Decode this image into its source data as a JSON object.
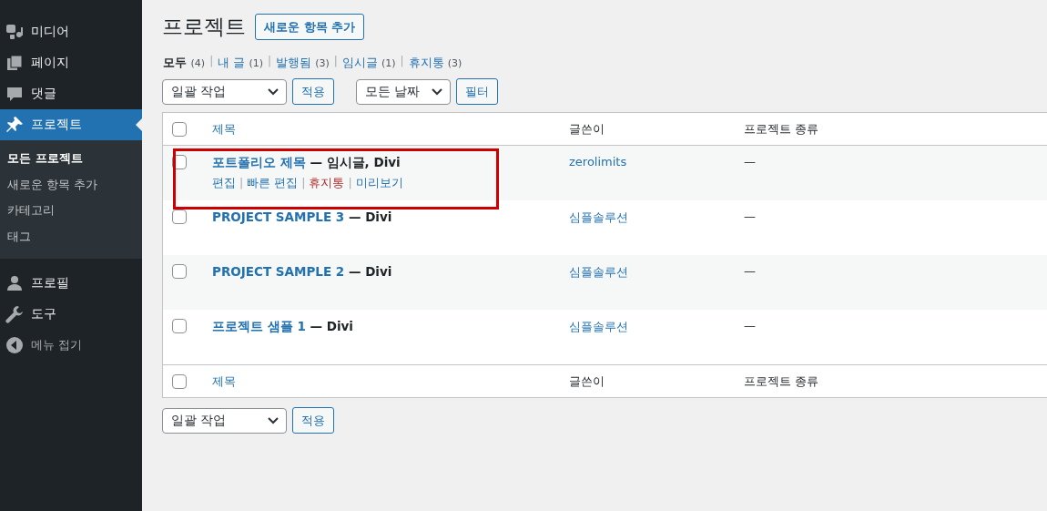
{
  "sidebar": {
    "items": [
      {
        "label": "미디어",
        "selected": false
      },
      {
        "label": "페이지",
        "selected": false
      },
      {
        "label": "댓글",
        "selected": false
      },
      {
        "label": "프로젝트",
        "selected": true,
        "expanded": true,
        "children": [
          {
            "label": "모든 프로젝트",
            "selected": true
          },
          {
            "label": "새로운 항목 추가",
            "selected": false
          },
          {
            "label": "카테고리",
            "selected": false
          },
          {
            "label": "태그",
            "selected": false
          }
        ]
      },
      {
        "label": "프로필",
        "selected": false
      },
      {
        "label": "도구",
        "selected": false
      }
    ],
    "collapse": "메뉴 접기"
  },
  "page": {
    "title": "프로젝트",
    "add_button": "새로운 항목 추가"
  },
  "views": [
    {
      "label": "모두",
      "count": "(4)",
      "selected": true
    },
    {
      "separator": "|",
      "label": "내 글",
      "count": "(1)",
      "selected": false
    },
    {
      "separator": "|",
      "label": "발행됨",
      "count": "(3)",
      "selected": false
    },
    {
      "separator": "|",
      "label": "임시글",
      "count": "(1)",
      "selected": false
    },
    {
      "separator": "|",
      "label": "휴지통",
      "count": "(3)",
      "selected": false
    }
  ],
  "top_actions": {
    "bulk": "일괄 작업",
    "apply": "적용",
    "date": "모든 날짜",
    "filter": "필터"
  },
  "table": {
    "header_checkbox": {
      "checked": false
    },
    "columns": [
      "제목",
      "글쓴이",
      "프로젝트 종류"
    ],
    "rows": [
      {
        "title": "포트폴리오 제목",
        "state": " — 임시글, Divi",
        "author": "zerolimits",
        "type": "—",
        "checked": false,
        "highlighted": true,
        "actions": [
          {
            "label": "편집",
            "kind": "normal"
          },
          {
            "separator": "|",
            "label": "빠른 편집",
            "kind": "normal"
          },
          {
            "separator": "|",
            "label": "휴지통",
            "kind": "delete"
          },
          {
            "separator": "|",
            "label": "미리보기",
            "kind": "normal"
          }
        ]
      },
      {
        "title": "PROJECT SAMPLE 3",
        "state": " — Divi",
        "author": "심플솔루션",
        "type": "—",
        "checked": false,
        "highlighted": false
      },
      {
        "title": "PROJECT SAMPLE 2",
        "state": " — Divi",
        "author": "심플솔루션",
        "type": "—",
        "checked": false,
        "highlighted": false
      },
      {
        "title": "프로젝트 샘플 1",
        "state": " — Divi",
        "author": "심플솔루션",
        "type": "—",
        "checked": false,
        "highlighted": false
      }
    ],
    "footer_checkbox": {
      "checked": false
    },
    "footer_columns": [
      "제목",
      "글쓴이",
      "프로젝트 종류"
    ]
  },
  "bottom_actions": {
    "bulk": "일괄 작업",
    "apply": "적용"
  }
}
